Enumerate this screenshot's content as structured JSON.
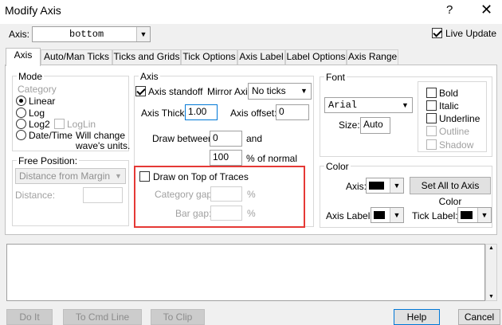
{
  "window": {
    "title": "Modify Axis",
    "help_glyph": "?",
    "close_glyph": "✕"
  },
  "axis_select": {
    "label": "Axis:",
    "value": "bottom"
  },
  "live_update": {
    "label": "Live Update",
    "checked": true
  },
  "tabs": [
    {
      "label": "Axis",
      "active": true
    },
    {
      "label": "Auto/Man Ticks"
    },
    {
      "label": "Ticks and Grids"
    },
    {
      "label": "Tick Options"
    },
    {
      "label": "Axis Label"
    },
    {
      "label": "Label Options"
    },
    {
      "label": "Axis Range"
    }
  ],
  "mode": {
    "title": "Mode",
    "category_label": "Category",
    "linear": "Linear",
    "log": "Log",
    "log2": "Log2",
    "loglin": "LogLin",
    "datetime": "Date/Time",
    "note_line1": "Will change",
    "note_line2": "wave's units."
  },
  "free_position": {
    "title": "Free Position:",
    "dropdown_value": "Distance from Margin",
    "distance_label": "Distance:"
  },
  "axis_group": {
    "title": "Axis",
    "standoff_label": "Axis standoff",
    "mirror_label": "Mirror Axis:",
    "mirror_value": "No ticks",
    "thick_label": "Axis Thick:",
    "thick_value": "1.00",
    "offset_label": "Axis offset:",
    "offset_value": "0",
    "draw_between_label": "Draw between",
    "draw_between_value1": "0",
    "and_label": "and",
    "draw_between_value2": "100",
    "pct_normal_label": "% of normal"
  },
  "draw_on_top": {
    "label": "Draw on Top of Traces",
    "category_gap_label": "Category gap:",
    "bar_gap_label": "Bar gap:",
    "pct": "%"
  },
  "font": {
    "title": "Font",
    "family_value": "Arial",
    "size_label": "Size:",
    "size_value": "Auto",
    "bold": "Bold",
    "italic": "Italic",
    "underline": "Underline",
    "outline": "Outline",
    "shadow": "Shadow"
  },
  "color": {
    "title": "Color",
    "axis_label": "Axis:",
    "set_all_button": "Set All to Axis Color",
    "axis_label_label": "Axis Label:",
    "tick_label_label": "Tick Label:",
    "swatch_color": "#000000"
  },
  "buttons": {
    "do_it": "Do It",
    "to_cmd_line": "To Cmd Line",
    "to_clip": "To Clip",
    "help": "Help",
    "cancel": "Cancel"
  },
  "arrows": {
    "down": "▼",
    "up": "▲"
  }
}
